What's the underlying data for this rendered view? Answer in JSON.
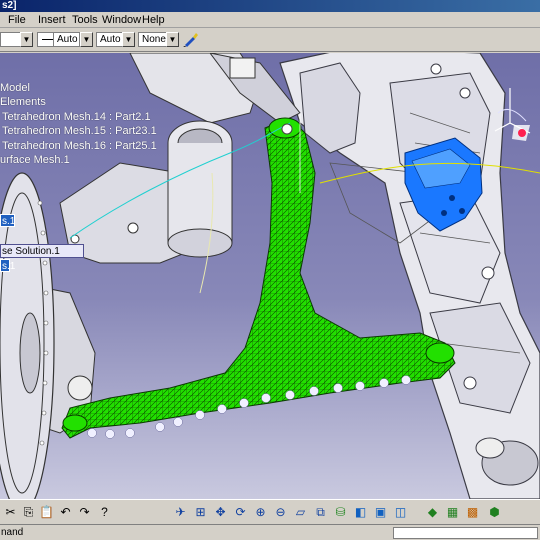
{
  "window": {
    "title": "s2]"
  },
  "menu": {
    "items": [
      {
        "label": "File"
      },
      {
        "label": "Insert"
      },
      {
        "label": "Tools"
      },
      {
        "label": "Window"
      },
      {
        "label": "Help"
      }
    ]
  },
  "toolbar": {
    "color_combo": "",
    "line_combo": "",
    "thickness_combo": "Auto",
    "linetype_combo": "Auto",
    "layer_combo": "None"
  },
  "tree": {
    "lines": [
      "Model",
      "Elements",
      "Tetrahedron Mesh.14 : Part2.1",
      "Tetrahedron Mesh.15 : Part23.1",
      "Tetrahedron Mesh.16 : Part25.1",
      "urface Mesh.1"
    ],
    "selected_a": "s.1",
    "solution": "se Solution.1",
    "selected_b": "s.1"
  },
  "status": {
    "text": "nand"
  },
  "colors": {
    "mesh": "#22e000",
    "background_top": "#6f6fa8",
    "highlight_part": "#1a78ff",
    "selection": "#2060c0"
  }
}
